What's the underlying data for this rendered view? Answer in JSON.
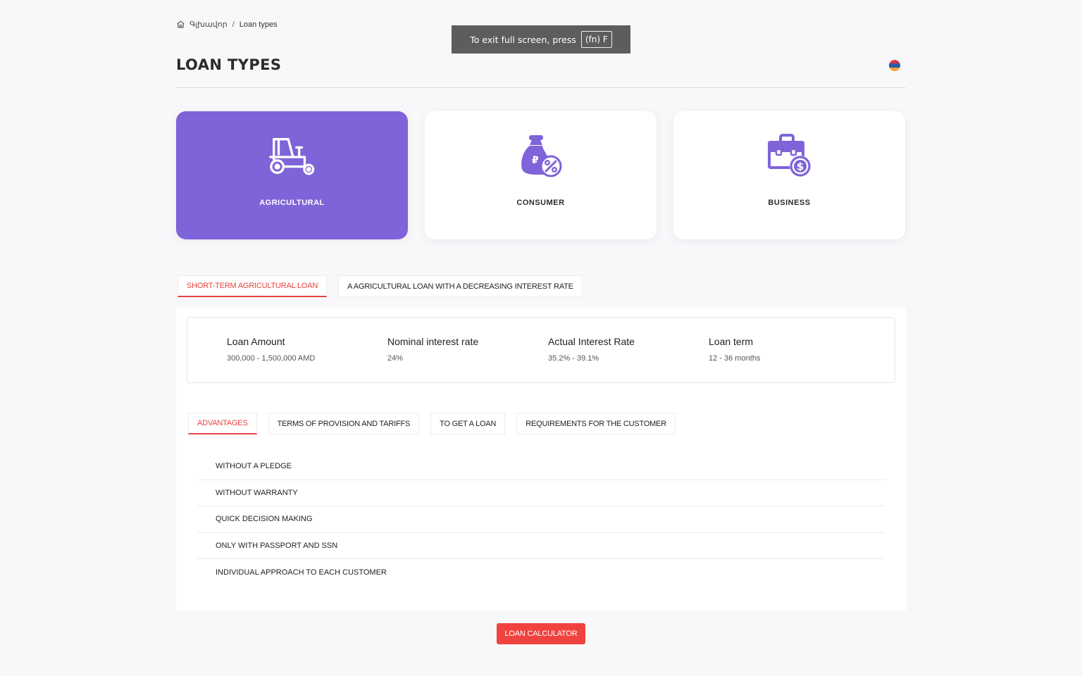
{
  "breadcrumb": {
    "home": "Գլխավոր",
    "current": "Loan types"
  },
  "fullscreen_toast": {
    "text": "To exit full screen, press",
    "key": "(fn) F"
  },
  "page": {
    "title": "LOAN TYPES"
  },
  "colors": {
    "accent": "#7f63d8",
    "active_red": "#e8413f",
    "button_red": "#f0433f"
  },
  "loan_types": [
    {
      "label": "AGRICULTURAL",
      "icon": "tractor-icon",
      "active": true
    },
    {
      "label": "CONSUMER",
      "icon": "money-bag-percent-icon",
      "active": false
    },
    {
      "label": "BUSINESS",
      "icon": "briefcase-dollar-icon",
      "active": false
    }
  ],
  "sub_tabs": [
    {
      "label": "SHORT-TERM AGRICULTURAL LOAN",
      "active": true
    },
    {
      "label": "A AGRICULTURAL LOAN WITH A DECREASING INTEREST RATE",
      "active": false
    }
  ],
  "loan_info": [
    {
      "label": "Loan Amount",
      "value": "300,000 - 1,500,000 AMD"
    },
    {
      "label": "Nominal interest rate",
      "value": "24%"
    },
    {
      "label": "Actual Interest Rate",
      "value": "35.2% - 39.1%"
    },
    {
      "label": "Loan term",
      "value": "12 - 36 months"
    }
  ],
  "detail_tabs": [
    {
      "label": "ADVANTAGES",
      "active": true
    },
    {
      "label": "TERMS OF PROVISION AND TARIFFS",
      "active": false
    },
    {
      "label": "TO GET A LOAN",
      "active": false
    },
    {
      "label": "REQUIREMENTS FOR THE CUSTOMER",
      "active": false
    }
  ],
  "advantages": [
    "WITHOUT A PLEDGE",
    "WITHOUT WARRANTY",
    "QUICK DECISION MAKING",
    "ONLY WITH PASSPORT AND SSN",
    "INDIVIDUAL APPROACH TO EACH CUSTOMER"
  ],
  "calculator_button": "LOAN CALCULATOR"
}
